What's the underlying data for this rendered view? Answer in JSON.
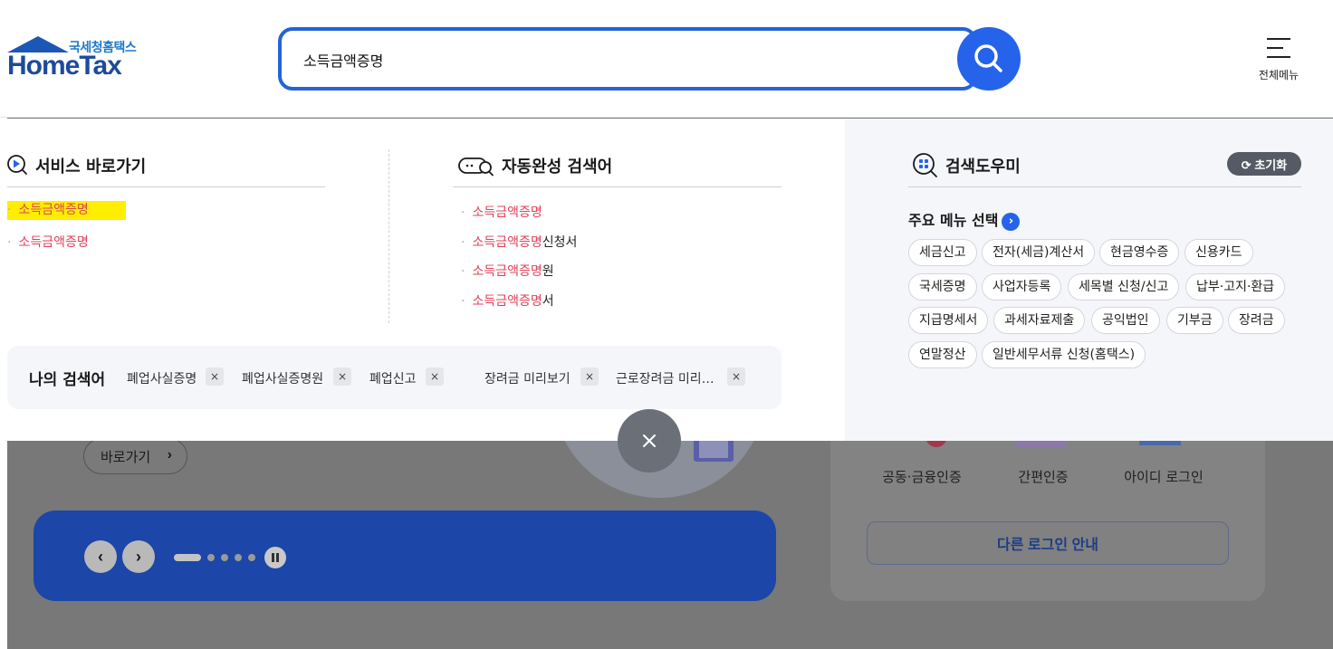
{
  "header": {
    "logo_kor": "국세청홈택스",
    "logo_eng": "HomeTax",
    "search_value": "소득금액증명",
    "all_menu_label": "전체메뉴"
  },
  "service_shortcut": {
    "title": "서비스 바로가기",
    "items": [
      "소득금액증명",
      "소득금액증명"
    ]
  },
  "autocomplete": {
    "title": "자동완성 검색어",
    "items": [
      {
        "match": "소득금액증명",
        "rest": ""
      },
      {
        "match": "소득금액증명",
        "rest": "신청서"
      },
      {
        "match": "소득금액증명",
        "rest": "원"
      },
      {
        "match": "소득금액증명",
        "rest": "서"
      }
    ]
  },
  "recent_searches": {
    "title": "나의 검색어",
    "items": [
      "폐업사실증명",
      "폐업사실증명원",
      "폐업신고",
      "장려금 미리보기",
      "근로장려금 미리…"
    ],
    "remove_label": "×"
  },
  "search_helper": {
    "title": "검색도우미",
    "reset_label": "초기화",
    "menu_select_label": "주요 메뉴 선택",
    "chips": [
      "세금신고",
      "전자(세금)계산서",
      "현금영수증",
      "신용카드",
      "국세증명",
      "사업자등록",
      "세목별 신청/신고",
      "납부·고지·환급",
      "지급명세서",
      "과세자료제출",
      "공익법인",
      "기부금",
      "장려금",
      "연말정산",
      "일반세무서류 신청(홈택스)"
    ]
  },
  "background": {
    "shortcut_button": "바로가기",
    "login_options": [
      "공동·금융인증",
      "간편인증",
      "아이디 로그인"
    ],
    "other_login_button": "다른 로그인 안내"
  },
  "colors": {
    "accent": "#2563eb",
    "match_text": "#e2405a",
    "highlight": "#ffee00",
    "banner": "#1c46a8"
  }
}
